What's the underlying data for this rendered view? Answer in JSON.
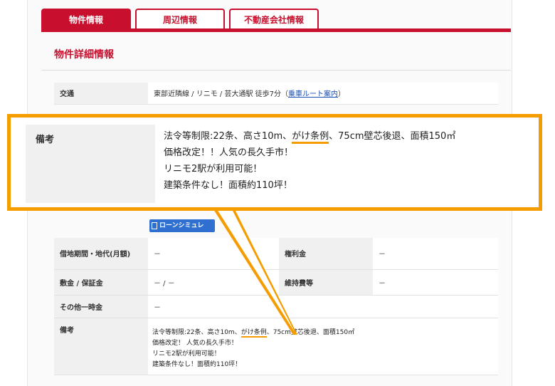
{
  "tabs": [
    "物件情報",
    "周辺情報",
    "不動産会社情報"
  ],
  "section_title": "物件詳細情報",
  "access": {
    "label": "交通",
    "value": "東部近隣線 / リニモ / 芸大通駅 徒歩7分",
    "link": "乗車ルート案内"
  },
  "loan_button": "ローンシミュレ",
  "callout": {
    "label": "備考",
    "lines": [
      "法令等制限:22条、高さ10m、",
      "がけ条例",
      "、75cm壁芯後退、面積150㎡",
      "価格改定！！人気の長久手市！",
      "リニモ2駅が利用可能！",
      "建築条件なし！面積約110坪！"
    ]
  },
  "rows": [
    {
      "label": "借地期間・地代(月額)",
      "value": "－",
      "label2": "権利金",
      "value2": "－"
    },
    {
      "label": "敷金 / 保証金",
      "value": "－ / －",
      "label2": "維持費等",
      "value2": "－"
    },
    {
      "label": "その他一時金",
      "value": "－"
    }
  ],
  "notes": {
    "label": "備考",
    "lines": [
      "法令等制限:22条、高さ10m、",
      "がけ条例",
      "、75cm壁芯後退、面積150㎡",
      "価格改定！ 人気の長久手市！",
      "リニモ2駅が利用可能！",
      "建築条件なし！面積約110坪！"
    ]
  },
  "colors": {
    "brand": "#c8102e",
    "highlight": "#f59c00",
    "link": "#1a4fb3"
  }
}
